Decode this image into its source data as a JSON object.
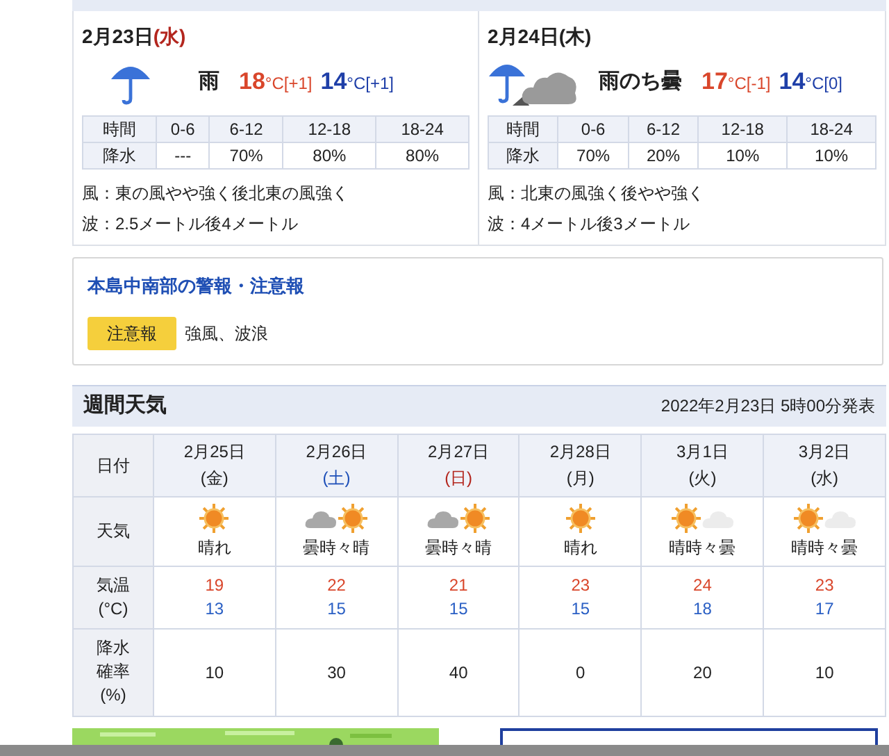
{
  "days": [
    {
      "date": "2月23日",
      "weekday": "(水)",
      "color": "#b3261e",
      "kind": "rain",
      "weather": "雨",
      "high": "18",
      "high_unit": "°C[+1]",
      "low": "14",
      "low_unit": "°C[+1]",
      "precip_header": [
        "時間",
        "0-6",
        "6-12",
        "12-18",
        "18-24"
      ],
      "precip_row": [
        "降水",
        "---",
        "70%",
        "80%",
        "80%"
      ],
      "wind": "風：東の風やや強く後北東の風強く",
      "wave": "波：2.5メートル後4メートル"
    },
    {
      "date": "2月24日",
      "weekday": "(木)",
      "color": "#222222",
      "kind": "rain_then_cloudy",
      "weather": "雨のち曇",
      "high": "17",
      "high_unit": "°C[-1]",
      "low": "14",
      "low_unit": "°C[0]",
      "precip_header": [
        "時間",
        "0-6",
        "6-12",
        "12-18",
        "18-24"
      ],
      "precip_row": [
        "降水",
        "70%",
        "20%",
        "10%",
        "10%"
      ],
      "wind": "風：北東の風強く後やや強く",
      "wave": "波：4メートル後3メートル"
    }
  ],
  "alerts": {
    "title": "本島中南部の警報・注意報",
    "badge": "注意報",
    "text": "強風、波浪"
  },
  "weekly": {
    "title": "週間天気",
    "issued": "2022年2月23日 5時00分発表",
    "row_labels": [
      [
        "日付"
      ],
      [
        "天気"
      ],
      [
        "気温",
        "(°C)"
      ],
      [
        "降水",
        "確率",
        "(%)"
      ]
    ],
    "days": [
      {
        "date": "2月25日",
        "weekday": "(金)",
        "color": "#222222",
        "kind": "sunny",
        "weather": "晴れ",
        "high": "19",
        "low": "13",
        "precip": "10"
      },
      {
        "date": "2月26日",
        "weekday": "(土)",
        "color": "#1d4fb8",
        "kind": "cloudy_sometimes_sunny",
        "weather": "曇時々晴",
        "high": "22",
        "low": "15",
        "precip": "30"
      },
      {
        "date": "2月27日",
        "weekday": "(日)",
        "color": "#b3261e",
        "kind": "cloudy_sometimes_sunny",
        "weather": "曇時々晴",
        "high": "21",
        "low": "15",
        "precip": "40"
      },
      {
        "date": "2月28日",
        "weekday": "(月)",
        "color": "#222222",
        "kind": "sunny",
        "weather": "晴れ",
        "high": "23",
        "low": "15",
        "precip": "0"
      },
      {
        "date": "3月1日",
        "weekday": "(火)",
        "color": "#222222",
        "kind": "sunny_sometimes_cloudy",
        "weather": "晴時々曇",
        "high": "24",
        "low": "18",
        "precip": "20"
      },
      {
        "date": "3月2日",
        "weekday": "(水)",
        "color": "#222222",
        "kind": "sunny_sometimes_cloudy",
        "weather": "晴時々曇",
        "high": "23",
        "low": "17",
        "precip": "10"
      }
    ]
  }
}
